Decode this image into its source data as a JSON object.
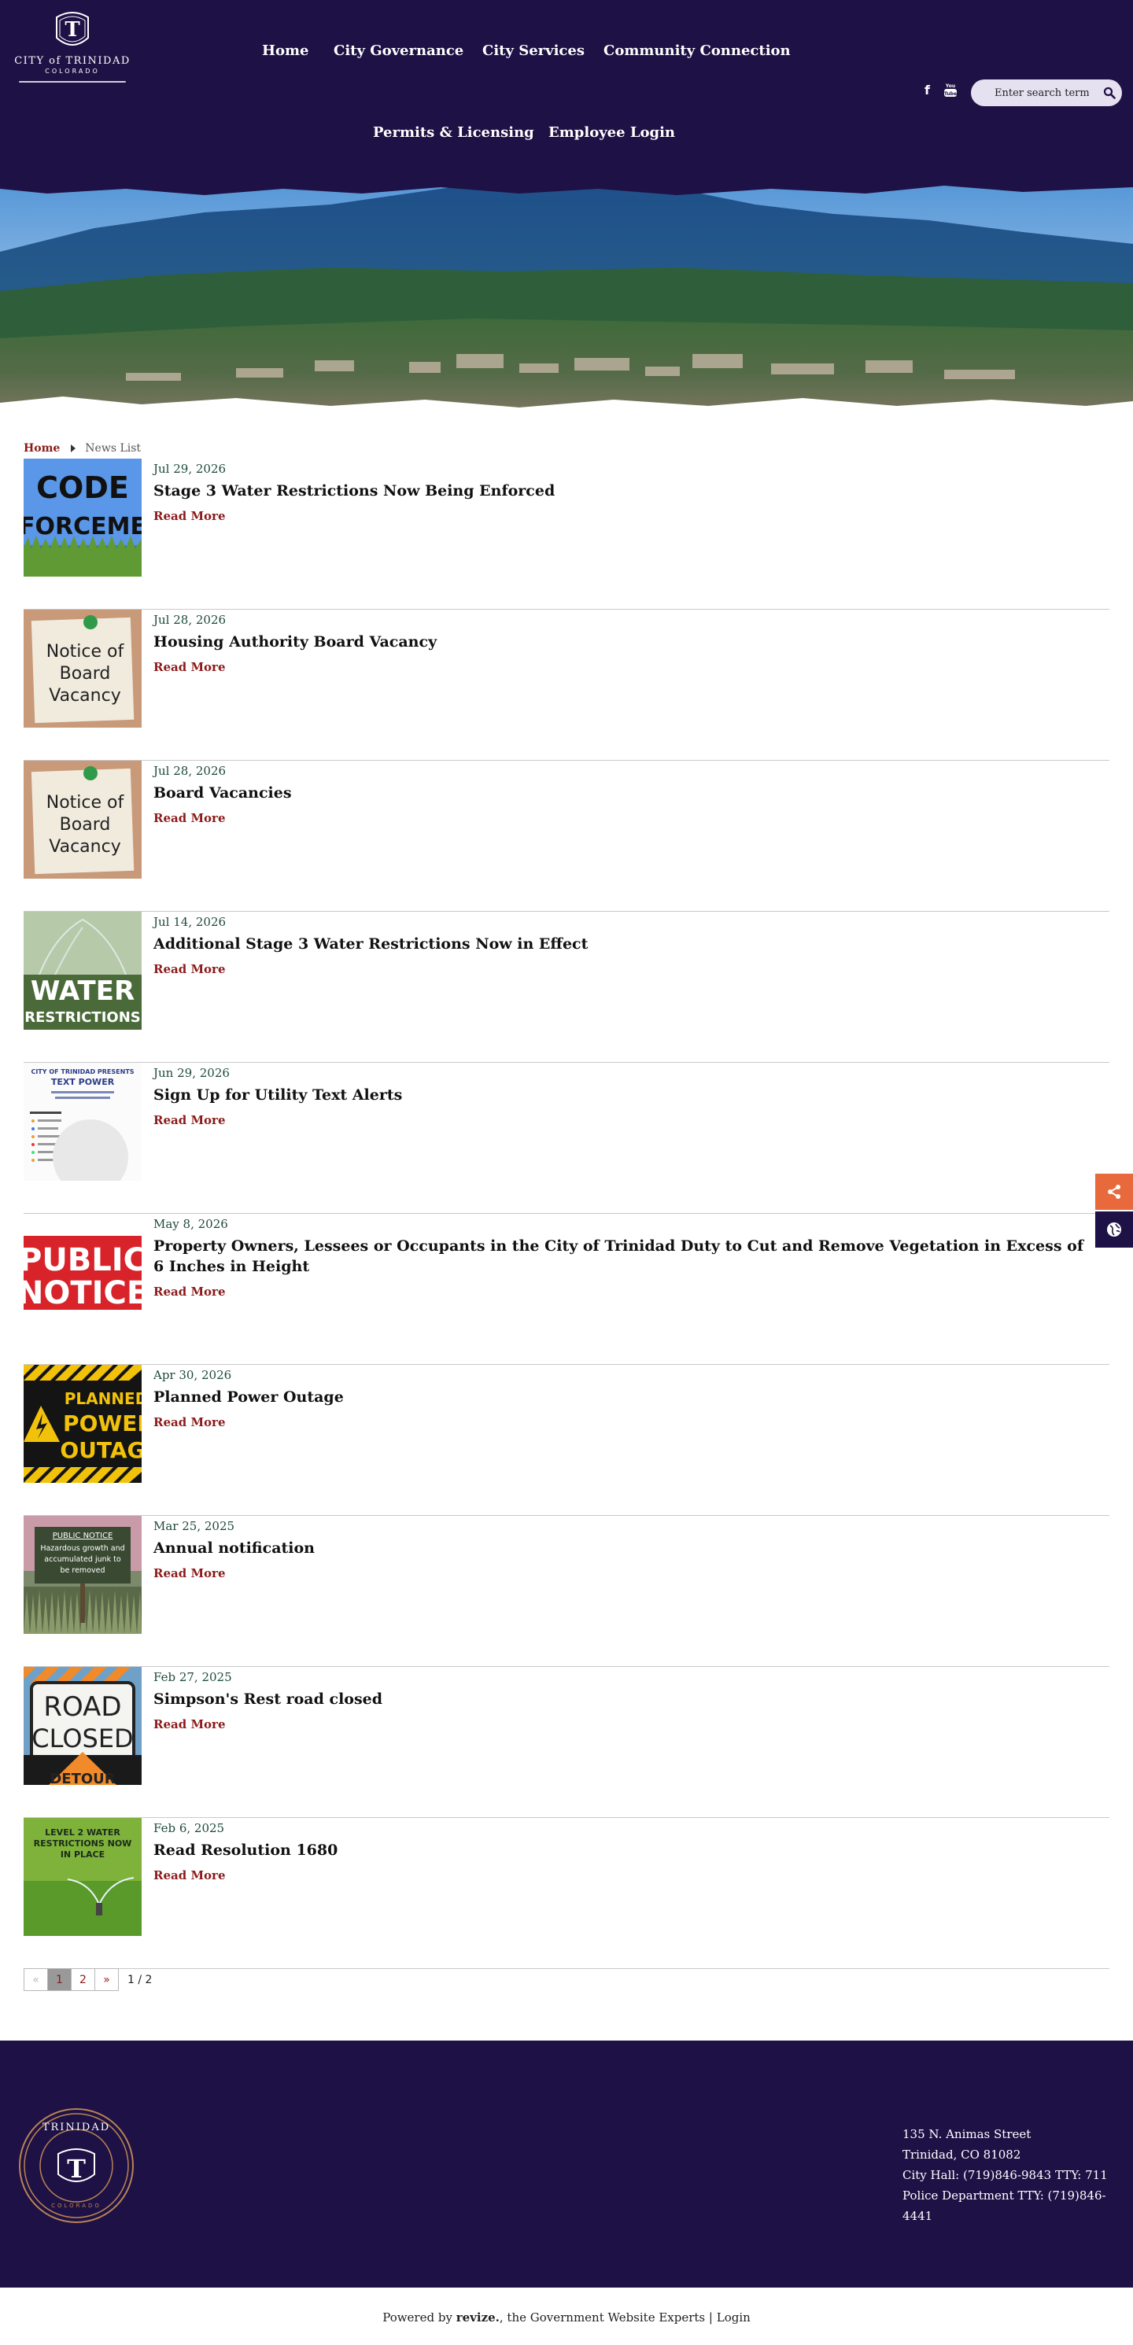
{
  "site": {
    "logo_name": "CITY of TRINIDAD",
    "logo_sub": "COLORADO"
  },
  "nav": {
    "row1": [
      "Home",
      "City Governance",
      "City Services",
      "Community Connection"
    ],
    "row2": [
      "Permits & Licensing",
      "Employee Login"
    ]
  },
  "social": {
    "facebook": "f",
    "youtube": "You Tube"
  },
  "search": {
    "placeholder": "Enter search term",
    "icon": "search-icon"
  },
  "breadcrumb": {
    "home": "Home",
    "current": "News List"
  },
  "news": [
    {
      "date": "Jul 29, 2026",
      "title": "Stage 3 Water Restrictions Now Being Enforced",
      "more": "Read More",
      "thumb": "code-enforcement",
      "thumb_text": [
        "CODE",
        "NFORCEMEN"
      ]
    },
    {
      "date": "Jul 28, 2026",
      "title": "Housing Authority Board Vacancy",
      "more": "Read More",
      "thumb": "board-vacancy-note",
      "thumb_text": [
        "Notice of",
        "Board",
        "Vacancy"
      ]
    },
    {
      "date": "Jul 28, 2026",
      "title": "Board Vacancies",
      "more": "Read More",
      "thumb": "board-vacancy-note",
      "thumb_text": [
        "Notice of",
        "Board",
        "Vacancy"
      ]
    },
    {
      "date": "Jul 14, 2026",
      "title": "Additional Stage 3 Water Restrictions Now in Effect",
      "more": "Read More",
      "thumb": "water-restrictions",
      "thumb_text": [
        "WATER",
        "RESTRICTIONS"
      ]
    },
    {
      "date": "Jun 29, 2026",
      "title": "Sign Up for Utility Text Alerts",
      "more": "Read More",
      "thumb": "text-power",
      "thumb_text": [
        "CITY OF TRINIDAD PRESENTS",
        "TEXT POWER"
      ]
    },
    {
      "date": "May 8, 2026",
      "title": "Property Owners, Lessees or Occupants in the City of Trinidad Duty to Cut and Remove Vegetation in Excess of 6 Inches in Height",
      "more": "Read More",
      "thumb": "public-notice",
      "thumb_text": [
        "PUBLIC",
        "NOTICE"
      ]
    },
    {
      "date": "Apr 30, 2026",
      "title": "Planned Power Outage",
      "more": "Read More",
      "thumb": "power-outage",
      "thumb_text": [
        "PLANNED",
        "POWER",
        "OUTAGE"
      ]
    },
    {
      "date": "Mar 25, 2025",
      "title": "Annual notification",
      "more": "Read More",
      "thumb": "public-notice-sign",
      "thumb_text": [
        "PUBLIC NOTICE",
        "Hazardous growth and",
        "accumulated junk to",
        "be removed"
      ]
    },
    {
      "date": "Feb 27, 2025",
      "title": "Simpson's Rest road closed",
      "more": "Read More",
      "thumb": "road-closed",
      "thumb_text": [
        "ROAD",
        "CLOSED",
        "DETOUR"
      ]
    },
    {
      "date": "Feb 6, 2025",
      "title": "Read Resolution 1680",
      "more": "Read More",
      "thumb": "level2-water",
      "thumb_text": [
        "LEVEL 2 WATER",
        "RESTRICTIONS NOW",
        "IN PLACE"
      ]
    }
  ],
  "pagination": {
    "prev": "«",
    "pages": [
      "1",
      "2"
    ],
    "current": "1",
    "next": "»",
    "info": "1 / 2"
  },
  "footer": {
    "seal_text": "TRINIDAD",
    "seal_sub": "COLORADO",
    "address": [
      "135 N. Animas Street",
      "Trinidad, CO 81082",
      "City Hall: (719)846-9843 TTY: 711",
      "Police Department TTY: (719)846-4441"
    ]
  },
  "bottom": {
    "powered_prefix": "Powered by",
    "brand": "revize.",
    "powered_suffix": ", the Government Website Experts |",
    "login": "Login"
  },
  "colors": {
    "header_bg": "#1e1145",
    "accent_red": "#8b1b1b",
    "date_green": "#1e4b3a",
    "share_orange": "#e8693c",
    "share_navy": "#1e1145"
  }
}
